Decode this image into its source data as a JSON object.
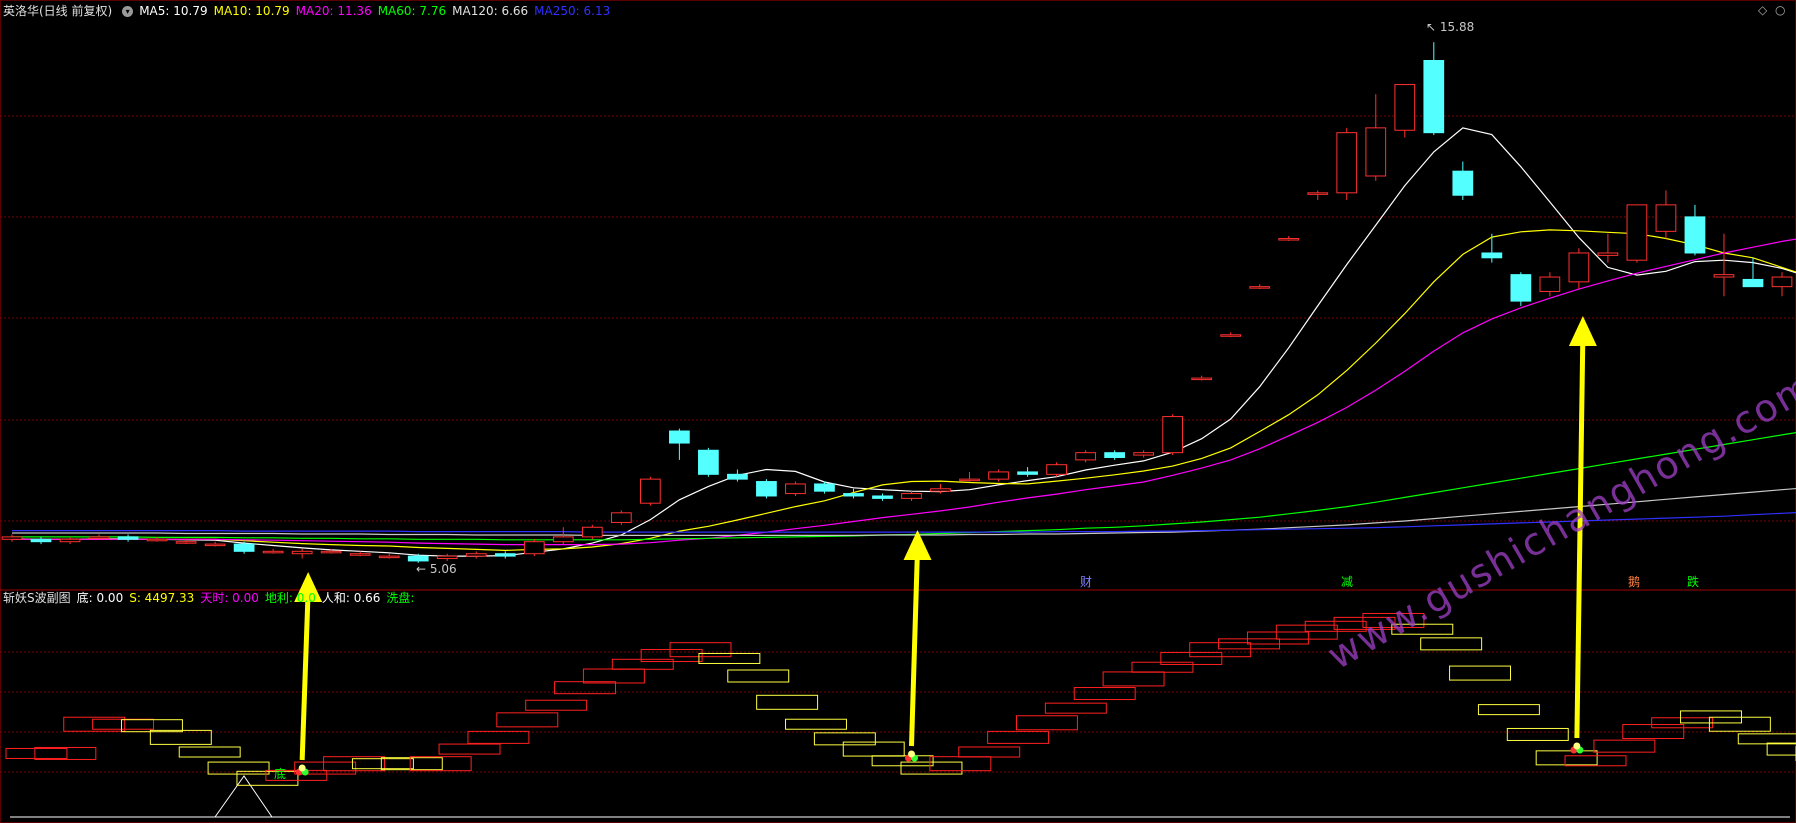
{
  "top_header": {
    "title": "英洛华(日线 前复权)",
    "ma_items": [
      {
        "label": "MA5: 10.79",
        "color": "#ffffff"
      },
      {
        "label": "MA10: 10.79",
        "color": "#ffff00"
      },
      {
        "label": "MA20: 11.36",
        "color": "#ff00ff"
      },
      {
        "label": "MA60: 7.76",
        "color": "#00ff00"
      },
      {
        "label": "MA120: 6.66",
        "color": "#e0e0e0"
      },
      {
        "label": "MA250: 6.13",
        "color": "#3030ff"
      }
    ]
  },
  "price_labels": {
    "high": "15.88",
    "low": "5.06"
  },
  "signal_marks": [
    {
      "text": "财",
      "color": "#8080ff"
    },
    {
      "text": "减",
      "color": "#00ff00"
    },
    {
      "text": "鹅",
      "color": "#ff8040"
    },
    {
      "text": "跌",
      "color": "#00ff00"
    }
  ],
  "sub_header": {
    "title": "斩妖S波副图",
    "items": [
      {
        "label": "底: 0.00",
        "color": "#ffffff"
      },
      {
        "label": "S: 4497.33",
        "color": "#ffff00"
      },
      {
        "label": "天时: 0.00",
        "color": "#ff00ff"
      },
      {
        "label": "地利: 0.0",
        "color": "#00ff00"
      },
      {
        "label": "人和: 0.66",
        "color": "#ffffff"
      },
      {
        "label": "洗盘:",
        "color": "#00ff00"
      }
    ],
    "bottom_label": "底"
  },
  "watermark": "www.gushichanghong.com",
  "colors": {
    "grid": "#7a0000",
    "up": "#ff3030",
    "down": "#54ffff",
    "arrow": "#ffff00"
  },
  "candles": [
    {
      "o": 5.55,
      "c": 5.6,
      "h": 5.65,
      "l": 5.5
    },
    {
      "o": 5.55,
      "c": 5.5,
      "h": 5.6,
      "l": 5.45
    },
    {
      "o": 5.5,
      "c": 5.55,
      "h": 5.6,
      "l": 5.45
    },
    {
      "o": 5.6,
      "c": 5.6,
      "h": 5.65,
      "l": 5.55
    },
    {
      "o": 5.6,
      "c": 5.55,
      "h": 5.65,
      "l": 5.5
    },
    {
      "o": 5.55,
      "c": 5.55,
      "h": 5.6,
      "l": 5.5
    },
    {
      "o": 5.5,
      "c": 5.5,
      "h": 5.55,
      "l": 5.45
    },
    {
      "o": 5.45,
      "c": 5.45,
      "h": 5.5,
      "l": 5.4
    },
    {
      "o": 5.45,
      "c": 5.3,
      "h": 5.5,
      "l": 5.25
    },
    {
      "o": 5.3,
      "c": 5.3,
      "h": 5.35,
      "l": 5.25
    },
    {
      "o": 5.25,
      "c": 5.3,
      "h": 5.35,
      "l": 5.15
    },
    {
      "o": 5.3,
      "c": 5.3,
      "h": 5.35,
      "l": 5.25
    },
    {
      "o": 5.25,
      "c": 5.25,
      "h": 5.3,
      "l": 5.2
    },
    {
      "o": 5.2,
      "c": 5.2,
      "h": 5.25,
      "l": 5.15
    },
    {
      "o": 5.2,
      "c": 5.1,
      "h": 5.25,
      "l": 5.06
    },
    {
      "o": 5.15,
      "c": 5.2,
      "h": 5.25,
      "l": 5.1
    },
    {
      "o": 5.2,
      "c": 5.25,
      "h": 5.3,
      "l": 5.15
    },
    {
      "o": 5.25,
      "c": 5.2,
      "h": 5.3,
      "l": 5.15
    },
    {
      "o": 5.25,
      "c": 5.5,
      "h": 5.55,
      "l": 5.2
    },
    {
      "o": 5.5,
      "c": 5.6,
      "h": 5.8,
      "l": 5.45
    },
    {
      "o": 5.6,
      "c": 5.8,
      "h": 5.85,
      "l": 5.55
    },
    {
      "o": 5.9,
      "c": 6.1,
      "h": 6.15,
      "l": 5.85
    },
    {
      "o": 6.3,
      "c": 6.8,
      "h": 6.85,
      "l": 6.25
    },
    {
      "o": 7.8,
      "c": 7.55,
      "h": 7.85,
      "l": 7.2
    },
    {
      "o": 7.4,
      "c": 6.9,
      "h": 7.45,
      "l": 6.85
    },
    {
      "o": 6.9,
      "c": 6.8,
      "h": 7.0,
      "l": 6.75
    },
    {
      "o": 6.75,
      "c": 6.45,
      "h": 6.8,
      "l": 6.4
    },
    {
      "o": 6.5,
      "c": 6.7,
      "h": 6.75,
      "l": 6.45
    },
    {
      "o": 6.7,
      "c": 6.55,
      "h": 6.75,
      "l": 6.5
    },
    {
      "o": 6.5,
      "c": 6.45,
      "h": 6.6,
      "l": 6.4
    },
    {
      "o": 6.45,
      "c": 6.4,
      "h": 6.5,
      "l": 6.35
    },
    {
      "o": 6.4,
      "c": 6.5,
      "h": 6.55,
      "l": 6.35
    },
    {
      "o": 6.55,
      "c": 6.6,
      "h": 6.7,
      "l": 6.5
    },
    {
      "o": 6.8,
      "c": 6.8,
      "h": 6.95,
      "l": 6.75
    },
    {
      "o": 6.8,
      "c": 6.95,
      "h": 7.0,
      "l": 6.75
    },
    {
      "o": 6.95,
      "c": 6.9,
      "h": 7.05,
      "l": 6.85
    },
    {
      "o": 6.9,
      "c": 7.1,
      "h": 7.15,
      "l": 6.85
    },
    {
      "o": 7.2,
      "c": 7.35,
      "h": 7.4,
      "l": 7.15
    },
    {
      "o": 7.35,
      "c": 7.25,
      "h": 7.4,
      "l": 7.2
    },
    {
      "o": 7.3,
      "c": 7.35,
      "h": 7.4,
      "l": 7.25
    },
    {
      "o": 7.35,
      "c": 8.1,
      "h": 8.15,
      "l": 7.3
    },
    {
      "o": 8.9,
      "c": 8.9,
      "h": 8.95,
      "l": 8.85
    },
    {
      "o": 9.8,
      "c": 9.8,
      "h": 9.85,
      "l": 9.75
    },
    {
      "o": 10.8,
      "c": 10.8,
      "h": 10.85,
      "l": 10.75
    },
    {
      "o": 11.8,
      "c": 11.8,
      "h": 11.85,
      "l": 11.75
    },
    {
      "o": 12.75,
      "c": 12.75,
      "h": 12.8,
      "l": 12.6
    },
    {
      "o": 12.75,
      "c": 14.0,
      "h": 14.1,
      "l": 12.6
    },
    {
      "o": 13.1,
      "c": 14.1,
      "h": 14.8,
      "l": 13.0
    },
    {
      "o": 14.05,
      "c": 15.0,
      "h": 15.0,
      "l": 13.9
    },
    {
      "o": 15.5,
      "c": 14.0,
      "h": 15.88,
      "l": 13.95
    },
    {
      "o": 13.2,
      "c": 12.7,
      "h": 13.4,
      "l": 12.6
    },
    {
      "o": 11.5,
      "c": 11.4,
      "h": 11.9,
      "l": 11.3
    },
    {
      "o": 11.05,
      "c": 10.5,
      "h": 11.1,
      "l": 10.4
    },
    {
      "o": 10.7,
      "c": 11.0,
      "h": 11.1,
      "l": 10.6
    },
    {
      "o": 10.9,
      "c": 11.5,
      "h": 11.6,
      "l": 10.75
    },
    {
      "o": 11.45,
      "c": 11.5,
      "h": 11.9,
      "l": 11.3
    },
    {
      "o": 11.35,
      "c": 12.5,
      "h": 12.5,
      "l": 11.3
    },
    {
      "o": 11.95,
      "c": 12.5,
      "h": 12.8,
      "l": 11.8
    },
    {
      "o": 12.25,
      "c": 11.5,
      "h": 12.5,
      "l": 11.45
    },
    {
      "o": 11.0,
      "c": 11.05,
      "h": 11.9,
      "l": 10.6
    },
    {
      "o": 10.95,
      "c": 10.8,
      "h": 11.4,
      "l": 10.8
    },
    {
      "o": 10.8,
      "c": 11.0,
      "h": 11.1,
      "l": 10.6
    }
  ],
  "ma_series": {
    "ma5": [
      5.56,
      5.55,
      5.55,
      5.56,
      5.56,
      5.55,
      5.54,
      5.53,
      5.47,
      5.42,
      5.37,
      5.33,
      5.3,
      5.27,
      5.22,
      5.2,
      5.2,
      5.21,
      5.28,
      5.35,
      5.47,
      5.64,
      5.96,
      6.37,
      6.65,
      6.88,
      7.0,
      6.96,
      6.74,
      6.62,
      6.58,
      6.55,
      6.54,
      6.58,
      6.68,
      6.77,
      6.85,
      6.99,
      7.09,
      7.18,
      7.36,
      7.64,
      8.05,
      8.72,
      9.53,
      10.4,
      11.26,
      12.08,
      12.9,
      13.6,
      14.1,
      13.96,
      13.29,
      12.56,
      11.82,
      11.2,
      11.04,
      11.12,
      11.32,
      11.35,
      11.3,
      11.18,
      10.99
    ],
    "ma10": [
      5.55,
      5.55,
      5.55,
      5.55,
      5.55,
      5.55,
      5.55,
      5.55,
      5.52,
      5.49,
      5.46,
      5.44,
      5.42,
      5.41,
      5.38,
      5.36,
      5.34,
      5.32,
      5.34,
      5.35,
      5.39,
      5.46,
      5.57,
      5.72,
      5.82,
      5.95,
      6.09,
      6.23,
      6.35,
      6.52,
      6.68,
      6.75,
      6.76,
      6.73,
      6.71,
      6.7,
      6.76,
      6.82,
      6.89,
      6.97,
      7.07,
      7.23,
      7.45,
      7.79,
      8.14,
      8.55,
      9.06,
      9.63,
      10.24,
      10.9,
      11.47,
      11.83,
      11.94,
      11.98,
      11.96,
      11.93,
      11.9,
      11.8,
      11.67,
      11.5,
      11.4,
      11.2,
      11.0
    ],
    "ma20": [
      5.55,
      5.55,
      5.55,
      5.55,
      5.55,
      5.55,
      5.55,
      5.55,
      5.54,
      5.53,
      5.52,
      5.51,
      5.5,
      5.49,
      5.47,
      5.46,
      5.45,
      5.44,
      5.44,
      5.44,
      5.44,
      5.45,
      5.48,
      5.53,
      5.57,
      5.63,
      5.7,
      5.77,
      5.84,
      5.92,
      6.0,
      6.07,
      6.14,
      6.22,
      6.32,
      6.41,
      6.49,
      6.58,
      6.66,
      6.74,
      6.88,
      7.03,
      7.2,
      7.43,
      7.7,
      7.98,
      8.29,
      8.65,
      9.04,
      9.46,
      9.84,
      10.13,
      10.36,
      10.56,
      10.75,
      10.92,
      11.08,
      11.22,
      11.36,
      11.5,
      11.62,
      11.74,
      11.84
    ],
    "ma60": [
      5.6,
      5.6,
      5.6,
      5.6,
      5.6,
      5.59,
      5.59,
      5.59,
      5.58,
      5.58,
      5.57,
      5.57,
      5.56,
      5.56,
      5.55,
      5.55,
      5.55,
      5.54,
      5.54,
      5.54,
      5.54,
      5.54,
      5.55,
      5.56,
      5.57,
      5.58,
      5.59,
      5.6,
      5.61,
      5.62,
      5.64,
      5.65,
      5.67,
      5.69,
      5.71,
      5.73,
      5.75,
      5.78,
      5.8,
      5.83,
      5.87,
      5.91,
      5.96,
      6.01,
      6.08,
      6.15,
      6.23,
      6.32,
      6.42,
      6.52,
      6.62,
      6.72,
      6.82,
      6.92,
      7.02,
      7.12,
      7.22,
      7.32,
      7.42,
      7.52,
      7.62,
      7.72,
      7.82
    ],
    "ma120": [
      5.68,
      5.68,
      5.68,
      5.68,
      5.68,
      5.68,
      5.67,
      5.67,
      5.67,
      5.67,
      5.66,
      5.66,
      5.66,
      5.65,
      5.65,
      5.65,
      5.64,
      5.64,
      5.64,
      5.64,
      5.63,
      5.63,
      5.63,
      5.63,
      5.63,
      5.63,
      5.63,
      5.63,
      5.63,
      5.63,
      5.64,
      5.64,
      5.64,
      5.65,
      5.65,
      5.66,
      5.66,
      5.67,
      5.68,
      5.69,
      5.7,
      5.72,
      5.74,
      5.76,
      5.79,
      5.82,
      5.85,
      5.89,
      5.93,
      5.98,
      6.03,
      6.08,
      6.13,
      6.18,
      6.23,
      6.28,
      6.33,
      6.38,
      6.43,
      6.48,
      6.53,
      6.58,
      6.63
    ],
    "ma250": [
      5.73,
      5.73,
      5.73,
      5.73,
      5.73,
      5.73,
      5.73,
      5.73,
      5.72,
      5.72,
      5.72,
      5.72,
      5.72,
      5.72,
      5.71,
      5.71,
      5.71,
      5.71,
      5.71,
      5.71,
      5.7,
      5.7,
      5.7,
      5.7,
      5.7,
      5.7,
      5.7,
      5.7,
      5.7,
      5.7,
      5.7,
      5.7,
      5.7,
      5.7,
      5.7,
      5.7,
      5.71,
      5.71,
      5.71,
      5.72,
      5.72,
      5.73,
      5.74,
      5.75,
      5.76,
      5.77,
      5.78,
      5.79,
      5.81,
      5.83,
      5.85,
      5.87,
      5.89,
      5.91,
      5.93,
      5.95,
      5.97,
      5.99,
      6.01,
      6.03,
      6.06,
      6.09,
      6.12
    ]
  },
  "subchart_steps": [
    {
      "v": 0.55,
      "t": "up"
    },
    {
      "v": 0.55,
      "t": "up"
    },
    {
      "v": 0.75,
      "t": "up"
    },
    {
      "v": 0.75,
      "t": "up"
    },
    {
      "v": 0.74,
      "t": "down"
    },
    {
      "v": 0.66,
      "t": "down"
    },
    {
      "v": 0.56,
      "t": "down"
    },
    {
      "v": 0.45,
      "t": "down"
    },
    {
      "v": 0.38,
      "t": "down"
    },
    {
      "v": 0.4,
      "t": "up"
    },
    {
      "v": 0.45,
      "t": "up"
    },
    {
      "v": 0.48,
      "t": "up"
    },
    {
      "v": 0.48,
      "t": "down"
    },
    {
      "v": 0.48,
      "t": "down"
    },
    {
      "v": 0.48,
      "t": "up"
    },
    {
      "v": 0.58,
      "t": "up"
    },
    {
      "v": 0.66,
      "t": "up"
    },
    {
      "v": 0.78,
      "t": "up"
    },
    {
      "v": 0.88,
      "t": "up"
    },
    {
      "v": 1.0,
      "t": "up"
    },
    {
      "v": 1.08,
      "t": "up"
    },
    {
      "v": 1.16,
      "t": "up"
    },
    {
      "v": 1.22,
      "t": "up"
    },
    {
      "v": 1.26,
      "t": "up"
    },
    {
      "v": 1.2,
      "t": "down"
    },
    {
      "v": 1.08,
      "t": "down"
    },
    {
      "v": 0.9,
      "t": "down"
    },
    {
      "v": 0.75,
      "t": "down"
    },
    {
      "v": 0.65,
      "t": "down"
    },
    {
      "v": 0.58,
      "t": "down"
    },
    {
      "v": 0.5,
      "t": "down"
    },
    {
      "v": 0.45,
      "t": "down"
    },
    {
      "v": 0.48,
      "t": "up"
    },
    {
      "v": 0.56,
      "t": "up"
    },
    {
      "v": 0.66,
      "t": "up"
    },
    {
      "v": 0.76,
      "t": "up"
    },
    {
      "v": 0.86,
      "t": "up"
    },
    {
      "v": 0.96,
      "t": "up"
    },
    {
      "v": 1.06,
      "t": "up"
    },
    {
      "v": 1.14,
      "t": "up"
    },
    {
      "v": 1.2,
      "t": "up"
    },
    {
      "v": 1.26,
      "t": "up"
    },
    {
      "v": 1.3,
      "t": "up"
    },
    {
      "v": 1.34,
      "t": "up"
    },
    {
      "v": 1.38,
      "t": "up"
    },
    {
      "v": 1.42,
      "t": "up"
    },
    {
      "v": 1.44,
      "t": "up"
    },
    {
      "v": 1.46,
      "t": "up"
    },
    {
      "v": 1.4,
      "t": "down"
    },
    {
      "v": 1.3,
      "t": "down"
    },
    {
      "v": 1.1,
      "t": "down"
    },
    {
      "v": 0.85,
      "t": "down"
    },
    {
      "v": 0.68,
      "t": "down"
    },
    {
      "v": 0.52,
      "t": "down"
    },
    {
      "v": 0.5,
      "t": "up"
    },
    {
      "v": 0.6,
      "t": "up"
    },
    {
      "v": 0.7,
      "t": "up"
    },
    {
      "v": 0.76,
      "t": "up"
    },
    {
      "v": 0.8,
      "t": "down"
    },
    {
      "v": 0.75,
      "t": "down"
    },
    {
      "v": 0.65,
      "t": "down"
    },
    {
      "v": 0.58,
      "t": "down"
    },
    {
      "v": 0.55,
      "t": "down"
    }
  ],
  "arrow_candles": [
    10,
    31,
    54
  ]
}
